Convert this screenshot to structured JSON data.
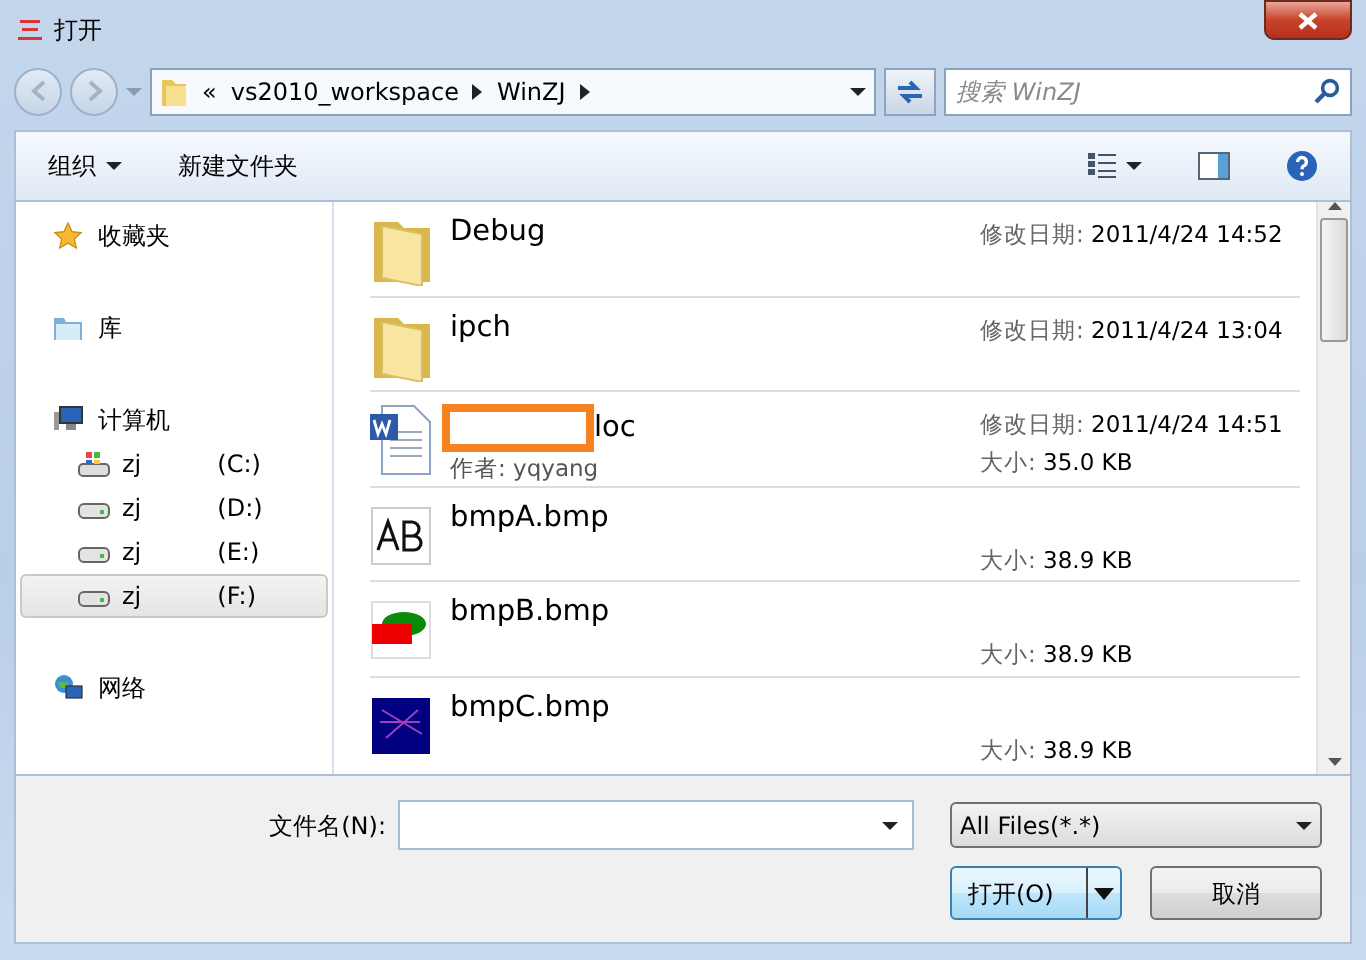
{
  "window": {
    "title": "打开"
  },
  "nav": {
    "back_disabled": true,
    "forward_disabled": true,
    "breadcrumb": [
      "«",
      "vs2010_workspace",
      "WinZJ"
    ]
  },
  "search": {
    "placeholder": "搜索 WinZJ"
  },
  "toolbar": {
    "organize": "组织",
    "new_folder": "新建文件夹"
  },
  "sidebar": [
    {
      "label": "收藏夹",
      "kind": "favorites",
      "selected": false
    },
    {
      "label": "库",
      "kind": "library",
      "selected": false
    },
    {
      "label": "计算机",
      "kind": "computer",
      "selected": false,
      "children": [
        {
          "label": "zj",
          "drive": "(C:)",
          "kind": "system-drive",
          "selected": false
        },
        {
          "label": "zj",
          "drive": "(D:)",
          "kind": "drive",
          "selected": false
        },
        {
          "label": "zj",
          "drive": "(E:)",
          "kind": "drive",
          "selected": false
        },
        {
          "label": "zj",
          "drive": "(F:)",
          "kind": "drive",
          "selected": true
        }
      ]
    },
    {
      "label": "网络",
      "kind": "network",
      "selected": false
    }
  ],
  "files": [
    {
      "name": "Debug",
      "kind": "folder",
      "meta": [
        {
          "label": "修改日期:",
          "value": "2011/4/24 14:52"
        }
      ]
    },
    {
      "name": "ipch",
      "kind": "folder",
      "meta": [
        {
          "label": "修改日期:",
          "value": "2011/4/24 13:04"
        }
      ]
    },
    {
      "name": "loc",
      "kind": "doc",
      "redacted": true,
      "meta_left": "作者: yqyang",
      "meta": [
        {
          "label": "修改日期:",
          "value": "2011/4/24 14:51"
        },
        {
          "label": "大小:",
          "value": "35.0 KB"
        }
      ]
    },
    {
      "name": "bmpA.bmp",
      "kind": "bmp-text",
      "meta": [
        {
          "label": "大小:",
          "value": "38.9 KB"
        }
      ]
    },
    {
      "name": "bmpB.bmp",
      "kind": "bmp-shape",
      "meta": [
        {
          "label": "大小:",
          "value": "38.9 KB"
        }
      ]
    },
    {
      "name": "bmpC.bmp",
      "kind": "bmp-dark",
      "meta": [
        {
          "label": "大小:",
          "value": "38.9 KB"
        }
      ]
    }
  ],
  "filename": {
    "label": "文件名(N):"
  },
  "filetype": {
    "value": "All Files(*.*)"
  },
  "buttons": [
    {
      "label": "打开(O)",
      "kind": "split",
      "default": true
    },
    {
      "label": "取消",
      "kind": "plain",
      "default": false
    }
  ]
}
